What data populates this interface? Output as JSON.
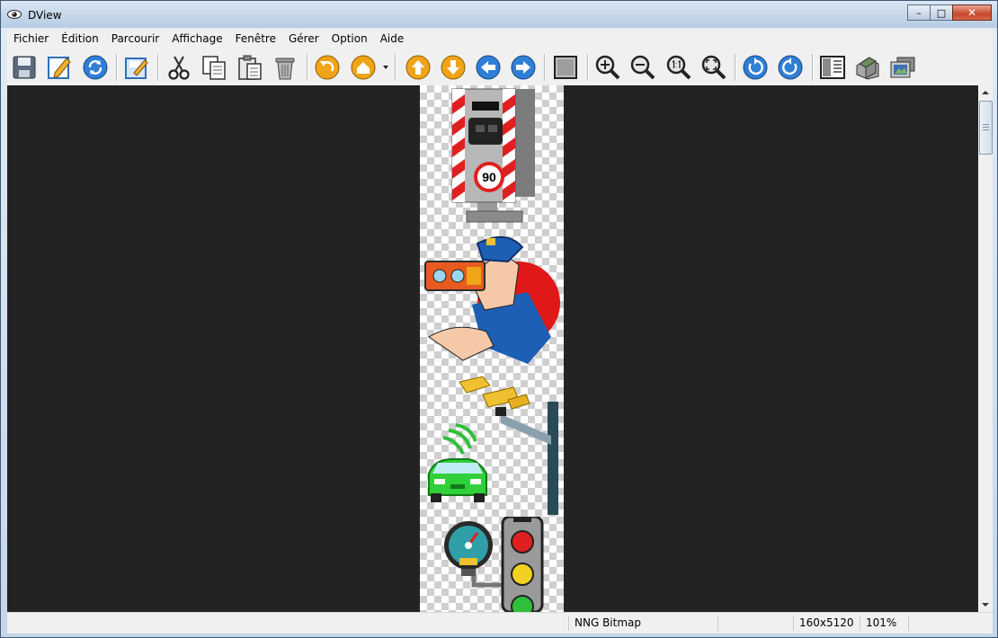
{
  "window": {
    "title": "DView",
    "minimize_glyph": "–",
    "maximize_glyph": "□",
    "close_glyph": "✕"
  },
  "menu": [
    "Fichier",
    "Édition",
    "Parcourir",
    "Affichage",
    "Fenêtre",
    "Gérer",
    "Option",
    "Aide"
  ],
  "toolbar_icons": [
    "save-icon",
    "edit-icon",
    "refresh-icon",
    "save-edit-icon",
    "cut-icon",
    "copy-icon",
    "paste-icon",
    "delete-icon",
    "undo-icon",
    "home-icon",
    "up-arrow-icon",
    "down-arrow-icon",
    "left-arrow-icon",
    "right-arrow-icon",
    "fullscreen-icon",
    "zoom-in-icon",
    "zoom-out-icon",
    "zoom-actual-icon",
    "zoom-fit-icon",
    "rotate-left-icon",
    "rotate-right-icon",
    "panel-icon",
    "stack-icon",
    "slideshow-icon"
  ],
  "image": {
    "speed_limit": "90",
    "subjects": [
      "speed-camera",
      "police-officer-radar",
      "traffic-camera-car",
      "speedometer-traffic-light"
    ]
  },
  "status": {
    "format": "NNG Bitmap",
    "dimensions": "160x5120",
    "zoom": "101%"
  },
  "colors": {
    "viewport_bg": "#232323",
    "accent_blue": "#2f7fd6",
    "accent_orange": "#f0a418",
    "close_red": "#c8482b"
  }
}
